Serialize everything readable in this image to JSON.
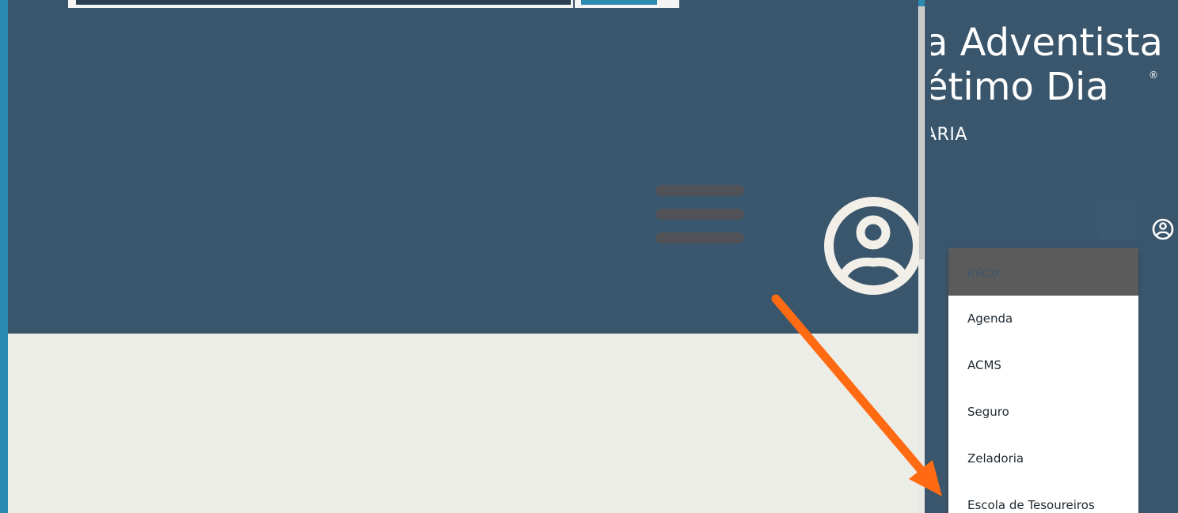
{
  "brand": {
    "line1": "a Adventista",
    "line2": "étimo Dia",
    "trademark": "®",
    "subtitle": "ARIA"
  },
  "menu": {
    "items": [
      {
        "label": "Início",
        "active": true
      },
      {
        "label": "Agenda",
        "active": false
      },
      {
        "label": "ACMS",
        "active": false
      },
      {
        "label": "Seguro",
        "active": false
      },
      {
        "label": "Zeladoria",
        "active": false
      },
      {
        "label": "Escola de Tesoureiros",
        "active": false
      }
    ]
  },
  "icons": {
    "menu": "hamburger-menu-icon",
    "user": "user-circle-icon",
    "arrow": "pointer-arrow"
  },
  "colors": {
    "header": "#3a566c",
    "content_bg": "#edede8",
    "outer_frame": "#2a8ab0",
    "arrow": "#ff6a13",
    "active_item_bg": "#5b5b5b"
  }
}
